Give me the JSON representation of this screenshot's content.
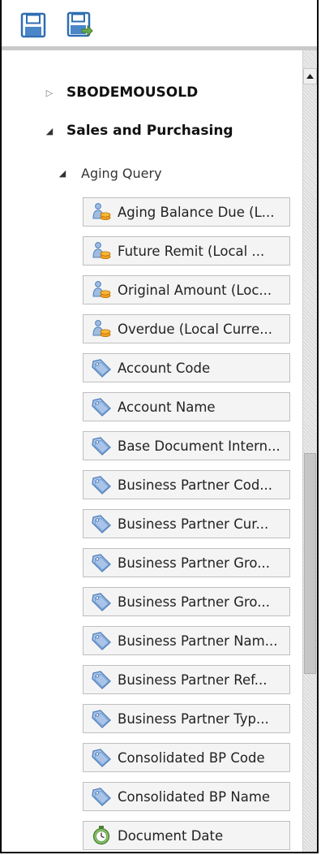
{
  "toolbar": {
    "save_icon": "save-icon",
    "save_as_icon": "save-as-icon"
  },
  "tree": {
    "root_collapsed": "SBODEMOUSOLD",
    "section": "Sales and Purchasing",
    "query": "Aging Query",
    "fields": [
      {
        "label": "Aging Balance Due (L...",
        "icon": "measure-icon"
      },
      {
        "label": "Future Remit (Local ...",
        "icon": "measure-icon"
      },
      {
        "label": "Original Amount (Loc...",
        "icon": "measure-icon"
      },
      {
        "label": "Overdue (Local Curre...",
        "icon": "measure-icon"
      },
      {
        "label": "Account Code",
        "icon": "dimension-tag-icon"
      },
      {
        "label": "Account Name",
        "icon": "dimension-tag-icon"
      },
      {
        "label": "Base Document Intern...",
        "icon": "dimension-tag-icon"
      },
      {
        "label": "Business Partner Cod...",
        "icon": "dimension-tag-icon"
      },
      {
        "label": "Business Partner Cur...",
        "icon": "dimension-tag-icon"
      },
      {
        "label": "Business Partner Gro...",
        "icon": "dimension-tag-icon"
      },
      {
        "label": "Business Partner Gro...",
        "icon": "dimension-tag-icon"
      },
      {
        "label": "Business Partner Nam...",
        "icon": "dimension-tag-icon"
      },
      {
        "label": "Business Partner Ref...",
        "icon": "dimension-tag-icon"
      },
      {
        "label": "Business Partner Typ...",
        "icon": "dimension-tag-icon"
      },
      {
        "label": "Consolidated BP Code",
        "icon": "dimension-tag-icon"
      },
      {
        "label": "Consolidated BP Name",
        "icon": "dimension-tag-icon"
      },
      {
        "label": "Document Date",
        "icon": "date-timer-icon"
      }
    ]
  },
  "colors": {
    "save_icon": "#3a7cc4",
    "tag_icon": "#6f9bd1",
    "measure_coin": "#f0a020",
    "timer_icon": "#6aa84f"
  }
}
